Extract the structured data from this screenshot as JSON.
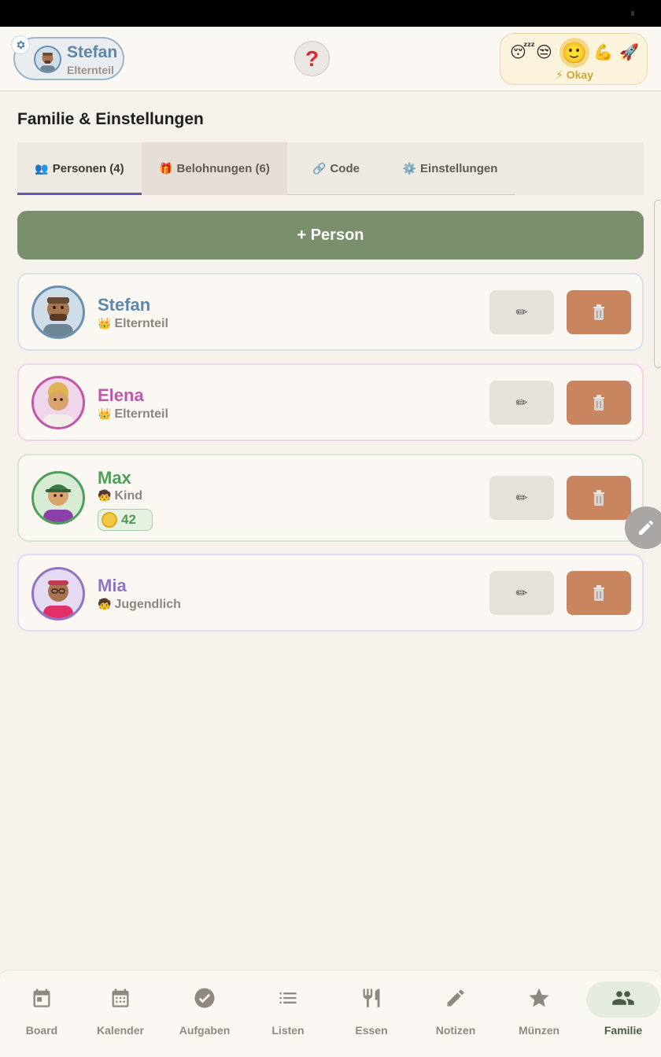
{
  "header": {
    "user_name": "Stefan",
    "user_role": "Elternteil",
    "help_label": "?",
    "mood": {
      "emojis": [
        "😴",
        "😒",
        "🙂",
        "💪",
        "🚀"
      ],
      "selected_index": 2,
      "label": "⚡ Okay"
    }
  },
  "page": {
    "title": "Familie & Einstellungen"
  },
  "tabs": [
    {
      "icon": "👥",
      "label": "Personen (4)"
    },
    {
      "icon": "🎁",
      "label": "Belohnungen (6)"
    },
    {
      "icon": "🔗",
      "label": "Code"
    },
    {
      "icon": "⚙️",
      "label": "Einstellungen"
    }
  ],
  "add_person_label": "+ Person",
  "persons": [
    {
      "name": "Stefan",
      "role_icon": "👑",
      "role": "Elternteil",
      "color": "#5b87ad"
    },
    {
      "name": "Elena",
      "role_icon": "👑",
      "role": "Elternteil",
      "color": "#c256a8"
    },
    {
      "name": "Max",
      "role_icon": "🧒",
      "role": "Kind",
      "coins": "42",
      "color": "#4f9e5a"
    },
    {
      "name": "Mia",
      "role_icon": "🧒",
      "role": "Jugendlich",
      "color": "#8f74c4"
    }
  ],
  "edit_icon": "✏",
  "nav": [
    {
      "label": "Board",
      "icon": "board-icon"
    },
    {
      "label": "Kalender",
      "icon": "calendar-icon"
    },
    {
      "label": "Aufgaben",
      "icon": "check-icon"
    },
    {
      "label": "Listen",
      "icon": "list-icon"
    },
    {
      "label": "Essen",
      "icon": "fork-knife-icon"
    },
    {
      "label": "Notizen",
      "icon": "pencil-icon"
    },
    {
      "label": "Münzen",
      "icon": "star-icon"
    },
    {
      "label": "Familie",
      "icon": "people-icon"
    }
  ],
  "colors": {
    "accent_purple": "#6a55b0",
    "add_button": "#7a8f6c",
    "delete_button": "#c98560"
  }
}
